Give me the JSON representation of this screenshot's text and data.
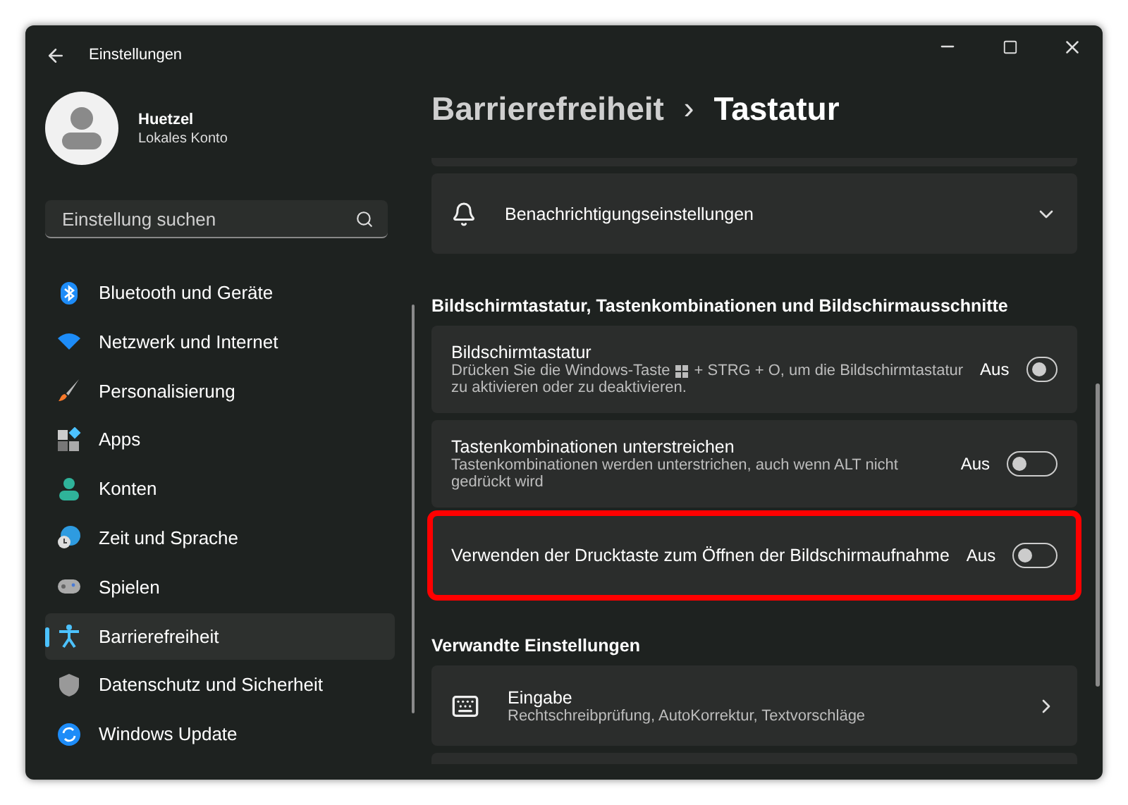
{
  "window": {
    "title": "Einstellungen"
  },
  "profile": {
    "name": "Huetzel",
    "account": "Lokales Konto"
  },
  "search": {
    "placeholder": "Einstellung suchen"
  },
  "sidebar": {
    "items": [
      {
        "label": "Bluetooth und Geräte",
        "selected": false
      },
      {
        "label": "Netzwerk und Internet",
        "selected": false
      },
      {
        "label": "Personalisierung",
        "selected": false
      },
      {
        "label": "Apps",
        "selected": false
      },
      {
        "label": "Konten",
        "selected": false
      },
      {
        "label": "Zeit und Sprache",
        "selected": false
      },
      {
        "label": "Spielen",
        "selected": false
      },
      {
        "label": "Barrierefreiheit",
        "selected": true
      },
      {
        "label": "Datenschutz und Sicherheit",
        "selected": false
      },
      {
        "label": "Windows Update",
        "selected": false
      }
    ]
  },
  "breadcrumb": {
    "parent": "Barrierefreiheit",
    "separator": "›",
    "current": "Tastatur"
  },
  "notification_card": {
    "label": "Benachrichtigungseinstellungen",
    "expanded": false
  },
  "sections": [
    {
      "heading": "Bildschirmtastatur, Tastenkombinationen und Bildschirmausschnitte",
      "settings": [
        {
          "kind": "toggle",
          "title": "Bildschirmtastatur",
          "description_before": "Drücken Sie die Windows-Taste",
          "description": [
            "+ STRG + O, um die Bildschirmtastatur",
            "zu aktivieren oder zu deaktivieren."
          ],
          "state_text": "Aus",
          "on": false,
          "highlighted": false
        },
        {
          "kind": "toggle",
          "title": "Tastenkombinationen unterstreichen",
          "description": [
            "Tastenkombinationen werden unterstrichen, auch wenn ALT nicht",
            "gedrückt wird"
          ],
          "state_text": "Aus",
          "on": false,
          "highlighted": false
        },
        {
          "kind": "toggle",
          "title": "Verwenden der Drucktaste zum Öffnen der Bildschirmaufnahme",
          "state_text": "Aus",
          "on": false,
          "highlighted": true
        }
      ]
    },
    {
      "heading": "Verwandte Einstellungen",
      "settings": [
        {
          "kind": "link",
          "title": "Eingabe",
          "description": [
            "Rechtschreibprüfung, AutoKorrektur, Textvorschläge"
          ]
        }
      ]
    }
  ]
}
